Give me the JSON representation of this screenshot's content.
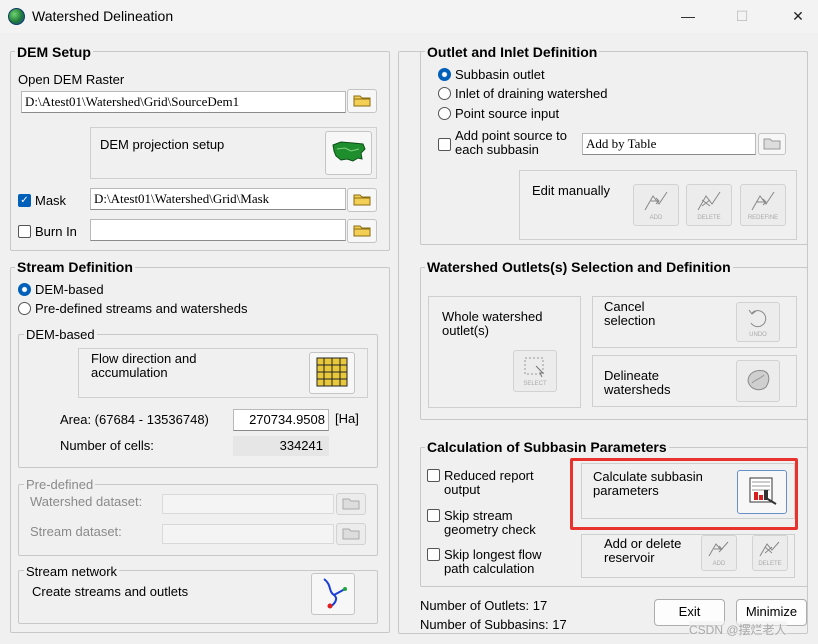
{
  "window": {
    "title": "Watershed Delineation",
    "minimize_glyph": "—",
    "maximize_glyph": "☐",
    "close_glyph": "✕"
  },
  "dem_setup": {
    "title": "DEM Setup",
    "open_label": "Open DEM Raster",
    "dem_path": "D:\\Atest01\\Watershed\\Grid\\SourceDem1",
    "projection_label": "DEM projection setup",
    "mask_label": "Mask",
    "mask_checked": true,
    "mask_path": "D:\\Atest01\\Watershed\\Grid\\Mask",
    "burn_label": "Burn In",
    "burn_checked": false,
    "burn_path": ""
  },
  "stream_definition": {
    "title": "Stream Definition",
    "option_dem": "DEM-based",
    "option_predefined": "Pre-defined streams and watersheds",
    "dem_based_title": "DEM-based",
    "flow_label": "Flow direction and\naccumulation",
    "area_label": "Area: (67684 - 13536748)",
    "area_value": "270734.9508",
    "area_unit": "[Ha]",
    "cells_label": "Number of cells:",
    "cells_value": "334241",
    "predefined_title": "Pre-defined",
    "watershed_dataset_label": "Watershed dataset:",
    "stream_dataset_label": "Stream dataset:",
    "network_title": "Stream network",
    "network_label": "Create streams and outlets"
  },
  "outlet_inlet": {
    "title": "Outlet and Inlet Definition",
    "options": [
      "Subbasin outlet",
      "Inlet of draining watershed",
      "Point source input"
    ],
    "selected_index": 0,
    "add_point_label": "Add point source to\neach subbasin",
    "add_point_checked": false,
    "add_by_table": "Add by Table",
    "edit_label": "Edit manually",
    "edit_buttons": [
      "ADD",
      "DELETE",
      "REDEFINE"
    ]
  },
  "outlet_selection": {
    "title": "Watershed Outlets(s) Selection and Definition",
    "whole_label": "Whole watershed\noutlet(s)",
    "whole_icon_text": "SELECT",
    "cancel_label": "Cancel\nselection",
    "cancel_icon_text": "UNDO",
    "delineate_label": "Delineate\nwatersheds"
  },
  "subbasin_params": {
    "title": "Calculation of Subbasin Parameters",
    "checks": [
      "Reduced  report\noutput",
      "Skip stream\ngeometry check",
      "Skip longest flow\npath calculation"
    ],
    "calc_label": "Calculate subbasin\nparameters",
    "reservoir_label": "Add or delete\nreservoir",
    "reservoir_buttons": [
      "ADD",
      "DELETE"
    ]
  },
  "footer": {
    "outlets_label": "Number of Outlets: 17",
    "subbasins_label": "Number of Subbasins: 17",
    "exit_label": "Exit",
    "minimize_label": "Minimize",
    "watermark": "CSDN @摆烂老人"
  },
  "colors": {
    "accent": "#005fb8",
    "highlight": "#e8322d"
  }
}
